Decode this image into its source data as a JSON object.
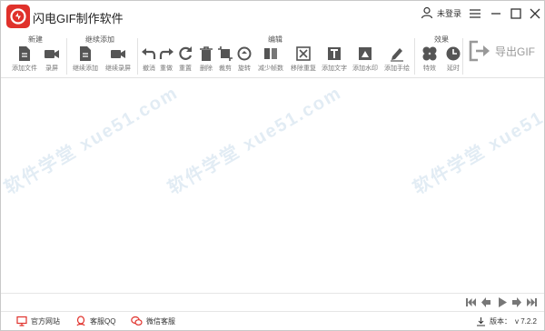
{
  "app": {
    "title": "闪电GIF制作软件"
  },
  "user": {
    "login_label": "未登录"
  },
  "toolbar": {
    "groups": {
      "new": "新建",
      "continue": "继续添加",
      "edit": "编辑",
      "effects": "效果"
    },
    "tools": {
      "add_file": "添加文件",
      "record": "录屏",
      "continue_add": "继续添加",
      "continue_record": "继续录屏",
      "undo": "撤消",
      "redo": "重做",
      "reset": "重置",
      "delete": "删除",
      "crop": "裁剪",
      "rotate": "旋转",
      "reduce_frames": "减少帧数",
      "remove_dup": "移除重复",
      "add_text": "添加文字",
      "add_watermark": "添加水印",
      "add_handwriting": "添加手绘",
      "effect": "特效",
      "delay": "延时"
    },
    "export_label": "导出GIF"
  },
  "watermark": "软件学堂  xue51.com",
  "status": {
    "website": "官方网站",
    "qq": "客服QQ",
    "wechat": "微信客服",
    "version_label": "版本：",
    "version_value": "v 7.2.2"
  },
  "colors": {
    "brand_red": "#e0312b",
    "icon_gray": "#555555",
    "watermark_blue": "#cfe0ee"
  }
}
